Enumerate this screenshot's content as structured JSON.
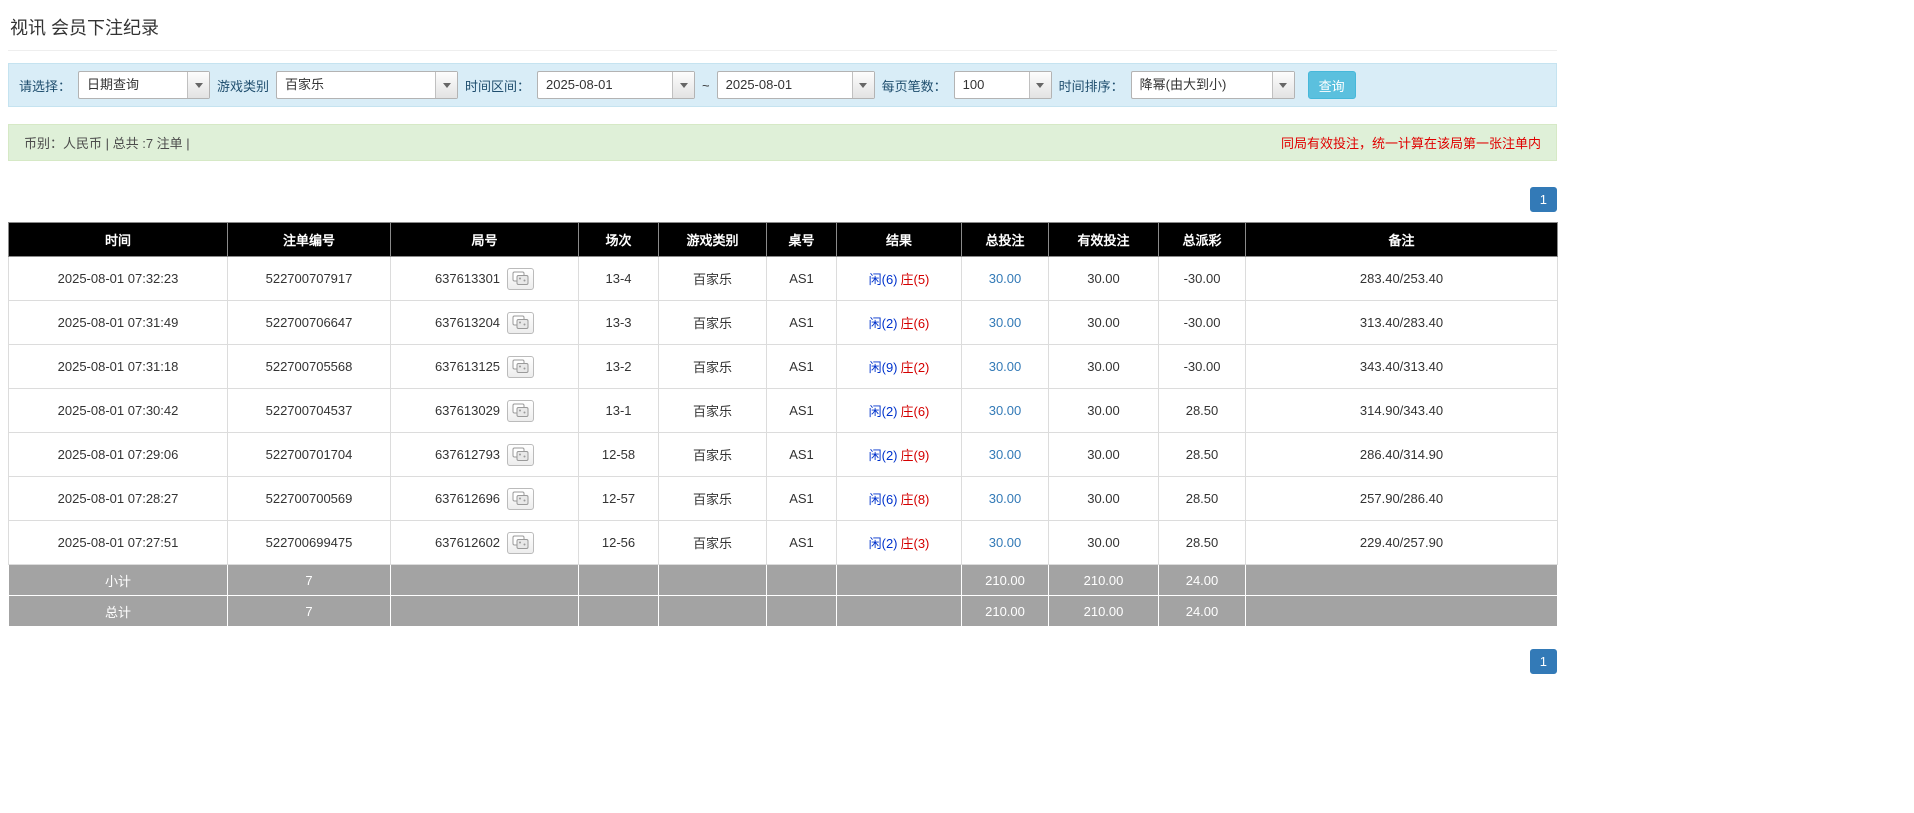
{
  "page": {
    "title": "视讯 会员下注纪录"
  },
  "filters": {
    "select_label": "请选择：",
    "select_value": "日期查询",
    "game_type_label": "游戏类别",
    "game_type_value": "百家乐",
    "time_range_label": "时间区间：",
    "time_from": "2025-08-01",
    "time_separator": "~",
    "time_to": "2025-08-01",
    "page_size_label": "每页笔数：",
    "page_size_value": "100",
    "sort_label": "时间排序：",
    "sort_value": "降幂(由大到小)",
    "search_button": "查询"
  },
  "summary": {
    "left": "币别：人民币 | 总共 :7 注单 |",
    "right": "同局有效投注，统一计算在该局第一张注单内"
  },
  "pagination": {
    "page": "1"
  },
  "table": {
    "headers": [
      "时间",
      "注单编号",
      "局号",
      "场次",
      "游戏类别",
      "桌号",
      "结果",
      "总投注",
      "有效投注",
      "总派彩",
      "备注"
    ],
    "rows": [
      {
        "time": "2025-08-01 07:32:23",
        "bet_id": "522700707917",
        "round": "637613301",
        "session": "13-4",
        "game": "百家乐",
        "table_no": "AS1",
        "result_player": "闲(6)",
        "result_banker": "庄(5)",
        "total_bet": "30.00",
        "valid_bet": "30.00",
        "payout": "-30.00",
        "remark": "283.40/253.40"
      },
      {
        "time": "2025-08-01 07:31:49",
        "bet_id": "522700706647",
        "round": "637613204",
        "session": "13-3",
        "game": "百家乐",
        "table_no": "AS1",
        "result_player": "闲(2)",
        "result_banker": "庄(6)",
        "total_bet": "30.00",
        "valid_bet": "30.00",
        "payout": "-30.00",
        "remark": "313.40/283.40"
      },
      {
        "time": "2025-08-01 07:31:18",
        "bet_id": "522700705568",
        "round": "637613125",
        "session": "13-2",
        "game": "百家乐",
        "table_no": "AS1",
        "result_player": "闲(9)",
        "result_banker": "庄(2)",
        "total_bet": "30.00",
        "valid_bet": "30.00",
        "payout": "-30.00",
        "remark": "343.40/313.40"
      },
      {
        "time": "2025-08-01 07:30:42",
        "bet_id": "522700704537",
        "round": "637613029",
        "session": "13-1",
        "game": "百家乐",
        "table_no": "AS1",
        "result_player": "闲(2)",
        "result_banker": "庄(6)",
        "total_bet": "30.00",
        "valid_bet": "30.00",
        "payout": "28.50",
        "remark": "314.90/343.40"
      },
      {
        "time": "2025-08-01 07:29:06",
        "bet_id": "522700701704",
        "round": "637612793",
        "session": "12-58",
        "game": "百家乐",
        "table_no": "AS1",
        "result_player": "闲(2)",
        "result_banker": "庄(9)",
        "total_bet": "30.00",
        "valid_bet": "30.00",
        "payout": "28.50",
        "remark": "286.40/314.90"
      },
      {
        "time": "2025-08-01 07:28:27",
        "bet_id": "522700700569",
        "round": "637612696",
        "session": "12-57",
        "game": "百家乐",
        "table_no": "AS1",
        "result_player": "闲(6)",
        "result_banker": "庄(8)",
        "total_bet": "30.00",
        "valid_bet": "30.00",
        "payout": "28.50",
        "remark": "257.90/286.40"
      },
      {
        "time": "2025-08-01 07:27:51",
        "bet_id": "522700699475",
        "round": "637612602",
        "session": "12-56",
        "game": "百家乐",
        "table_no": "AS1",
        "result_player": "闲(2)",
        "result_banker": "庄(3)",
        "total_bet": "30.00",
        "valid_bet": "30.00",
        "payout": "28.50",
        "remark": "229.40/257.90"
      }
    ],
    "subtotal": {
      "label": "小计",
      "count": "7",
      "total_bet": "210.00",
      "valid_bet": "210.00",
      "payout": "24.00"
    },
    "total": {
      "label": "总计",
      "count": "7",
      "total_bet": "210.00",
      "valid_bet": "210.00",
      "payout": "24.00"
    }
  },
  "icons": {
    "caret_down": "caret-down-icon",
    "roadmap": "roadmap-icon"
  },
  "colors": {
    "filter_bar_bg": "#d9edf7",
    "summary_bar_bg": "#dff0d8",
    "search_button": "#5bc0de",
    "pagination_active": "#337ab7",
    "table_header_bg": "#000000",
    "table_footer_bg": "#a3a3a3",
    "player_blue": "#0033cc",
    "banker_red": "#d40000",
    "negative_red": "#e00000",
    "note_red": "#e00000",
    "bet_link_blue": "#337ab7"
  }
}
